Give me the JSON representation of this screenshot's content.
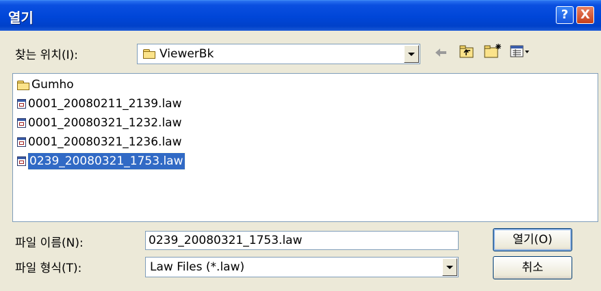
{
  "window": {
    "title": "열기"
  },
  "titlebar": {
    "help_label": "?",
    "close_label": "X"
  },
  "look_in": {
    "label": "찾는 위치(I):",
    "value": "ViewerBk"
  },
  "toolbar": {
    "back_icon": "back-arrow-icon",
    "up_icon": "up-folder-icon",
    "new_folder_icon": "new-folder-icon",
    "view_menu_icon": "view-menu-icon"
  },
  "files": [
    {
      "name": "Gumho",
      "type": "folder",
      "selected": false
    },
    {
      "name": "0001_20080211_2139.law",
      "type": "file",
      "selected": false
    },
    {
      "name": "0001_20080321_1232.law",
      "type": "file",
      "selected": false
    },
    {
      "name": "0001_20080321_1236.law",
      "type": "file",
      "selected": false
    },
    {
      "name": "0239_20080321_1753.law",
      "type": "file",
      "selected": true
    }
  ],
  "filename": {
    "label": "파일 이름(N):",
    "value": "0239_20080321_1753.law"
  },
  "filetype": {
    "label": "파일 형식(T):",
    "value": "Law Files (*.law)"
  },
  "buttons": {
    "open": "열기(O)",
    "cancel": "취소"
  }
}
